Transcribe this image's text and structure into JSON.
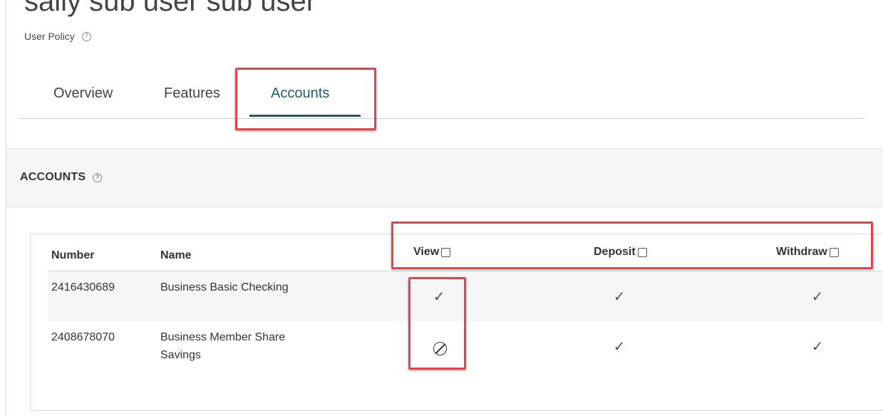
{
  "header": {
    "title": "sally sub user sub user",
    "subtitle": "User Policy",
    "help_icon": "?"
  },
  "tabs": [
    {
      "label": "Overview",
      "active": false
    },
    {
      "label": "Features",
      "active": false
    },
    {
      "label": "Accounts",
      "active": true
    }
  ],
  "section": {
    "title": "ACCOUNTS",
    "help_icon": "?"
  },
  "table": {
    "columns": [
      "Number",
      "Name",
      "View",
      "Deposit",
      "Withdraw"
    ],
    "rows": [
      {
        "number": "2416430689",
        "name": "Business Basic Checking",
        "view": "✓",
        "deposit": "✓",
        "withdraw": "✓"
      },
      {
        "number": "2408678070",
        "name": "Business Member Share Savings",
        "view": "⊘",
        "deposit": "✓",
        "withdraw": "✓"
      }
    ]
  },
  "colors": {
    "accent": "#1d5b6e",
    "highlight": "#e4434b",
    "row_shade": "#f6f6f6",
    "section_bg": "#f5f5f5"
  },
  "icons": {
    "allowed": "check-icon",
    "denied": "blocked-icon",
    "help": "help-icon"
  }
}
